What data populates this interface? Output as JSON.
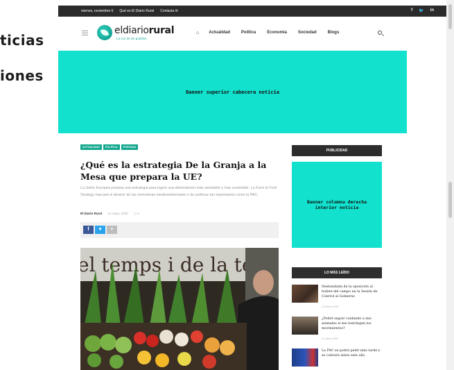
{
  "colors": {
    "accent": "#12e1cd",
    "topbar": "#2b2b2b",
    "tag": "#16a88f",
    "facebook": "#3b5998",
    "twitter": "#2aa3ef"
  },
  "overlay": {
    "line1": "ticias",
    "line2": "iones"
  },
  "topbar": {
    "date": "viernes, noviembre 6",
    "about": "Qué es El Diario Rural",
    "contact": "Contacta",
    "contact_icon": "envelope-icon",
    "social": [
      "f",
      "t",
      "in"
    ]
  },
  "header": {
    "menu_icon": "hamburger-icon",
    "logo_prefix": "eldiario",
    "logo_bold": "rural",
    "tagline": "La voz de los pueblos",
    "home_icon": "home-icon",
    "nav": [
      "Actualidad",
      "Política",
      "Economía",
      "Sociedad",
      "Blogs"
    ],
    "search_icon": "search-icon"
  },
  "banners": {
    "top": "Banner superior cabecera noticia",
    "side_line1": "Banner columna derecha",
    "side_line2": "interior noticia"
  },
  "article": {
    "tags": [
      "ACTUALIDAD",
      "POLÍTICA",
      "PORTADA"
    ],
    "title": "¿Qué es la estrategia De la Granja a la Mesa que prepara la UE?",
    "excerpt": "La Unión Europea prepara una estrategia para lograr una alimentación más saludable y más sostenible. La Farm to Fork Strategy marcará el devenir de las normativas medioambientales o de políticas tan importantes como la PAC.",
    "author": "El Diario Rural",
    "date": "12 mayo, 2020",
    "comments": "0",
    "share": {
      "facebook": "f",
      "twitter": "t",
      "more": "+"
    },
    "photo_caption_text": "el temps i  de la terra"
  },
  "sidebar": {
    "publicidad": "PUBLICIDAD",
    "most_read_title": "LO MÁS LEÍDO",
    "most_read": [
      {
        "title": "Desbandada de la oposición al bufete del campo en la Sesión de Control al Gobierno",
        "date": "12 febrero 2020"
      },
      {
        "title": "¿Podré seguir cuidando a mis animales si me restringen los movimientos?",
        "date": "27 marzo 2020"
      },
      {
        "title": "La PAC se podrá pedir más tarde y se cobrará antes este año",
        "date": "2 abril 2020"
      }
    ]
  }
}
